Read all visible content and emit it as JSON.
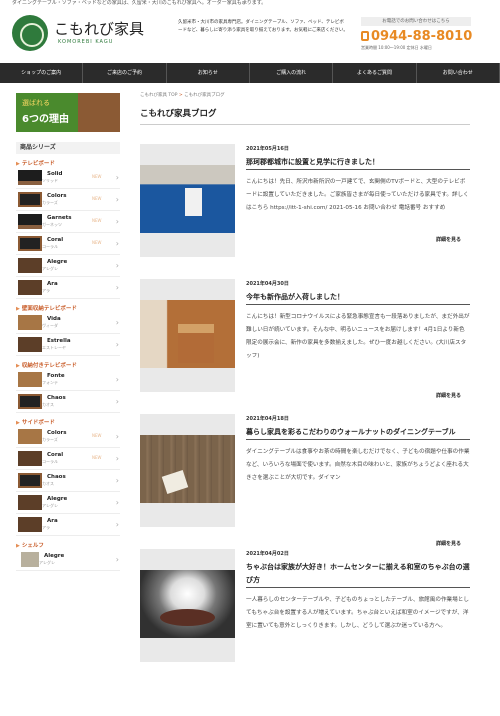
{
  "top_line": "ダイニングテーブル・ソファ・ベッドなどの家具は、久留米・大川のこもれび家具へ。オーダー家具も承ります。",
  "brand": {
    "name": "こもれび家具",
    "sub": "KOMOREBI KAGU"
  },
  "header_text": "久留米市・大川市の家具専門店。ダイニングテーブル、ソファ、ベッド、テレビボードなど、暮らしに寄り添う家具を取り揃えております。お気軽にご来店ください。",
  "contact": {
    "caption": "お電話でのお問い合わせはこちら",
    "phone": "0944-88-8010",
    "hours": "営業時間 10:00〜19:00  定休日 水曜日"
  },
  "nav": [
    "ショップのご案内",
    "ご来店のご予約",
    "お知らせ",
    "ご購入の流れ",
    "よくあるご質問",
    "お問い合わせ"
  ],
  "sidebar": {
    "banner": {
      "line1": "選ばれる",
      "line2": "6つの理由"
    },
    "series_title": "商品シリーズ",
    "categories": [
      {
        "name": "テレビボード",
        "items": [
          {
            "name": "Solid",
            "sub": "ソリッド"
          },
          {
            "name": "Colors",
            "sub": "カラーズ"
          },
          {
            "name": "Garnets",
            "sub": "ガーネッツ"
          },
          {
            "name": "Coral",
            "sub": "コーラル"
          },
          {
            "name": "Alegre",
            "sub": "アレグレ"
          },
          {
            "name": "Ara",
            "sub": "アラ"
          }
        ]
      },
      {
        "name": "壁面収納テレビボード",
        "items": [
          {
            "name": "Vida",
            "sub": "ヴィーダ"
          },
          {
            "name": "Estrella",
            "sub": "エストレーヤ"
          }
        ]
      },
      {
        "name": "収納付きテレビボード",
        "items": [
          {
            "name": "Fonte",
            "sub": "フォンテ"
          },
          {
            "name": "Chaos",
            "sub": "カオス"
          }
        ]
      },
      {
        "name": "サイドボード",
        "items": [
          {
            "name": "Colors",
            "sub": "カラーズ"
          },
          {
            "name": "Coral",
            "sub": "コーラル"
          },
          {
            "name": "Chaos",
            "sub": "カオス"
          },
          {
            "name": "Alegre",
            "sub": "アレグレ"
          },
          {
            "name": "Ara",
            "sub": "アラ"
          }
        ]
      },
      {
        "name": "シェルフ",
        "items": [
          {
            "name": "Alegre",
            "sub": "アレグレ"
          }
        ]
      }
    ],
    "new_label": "NEW"
  },
  "main": {
    "breadcrumb_home": "こもれび家具 TOP",
    "breadcrumb_current": "こもれび家具ブログ",
    "page_title": "こもれび家具ブログ",
    "more_label": "詳細を見る",
    "posts": [
      {
        "date": "2021年05月16日",
        "title": "那珂郡都城市に設置と見学に行きました！",
        "excerpt": "こんにちは！先日、所沢市新所沢の一戸建てで、玄関側のTVボードと、大型のテレビボードに設置していただきました。ご家族皆さまが毎日使っていただける家具です。詳しくはこちら https://itt-1-shi.com/ 2021-05-16 お問い合わせ 電話番号 おすすめ"
      },
      {
        "date": "2021年04月30日",
        "title": "今年も新作品が入荷しました！",
        "excerpt": "こんにちは！新型コロナウイルスによる緊急事態宣言も一段落ありましたが、まだ外出が難しい日が続いています。そんな中、明るいニュースをお届けします！4月1日より新色限定の展示会に、新作の家具を多数揃えました。ぜひ一度お越しください。(大川店スタッフ)"
      },
      {
        "date": "2021年04月18日",
        "title": "暮らし家具を彩るこだわりのウォールナットのダイニングテーブル",
        "excerpt": "ダイニングテーブルは食事やお茶の時間を楽しむだけでなく、子どもの宿題や仕事の作業など、いろいろな場面で使います。自然な木目の味わいと、家族がちょうどよく座れる大きさを選ぶことが大切です。ダイマン"
      },
      {
        "date": "2021年04月02日",
        "title": "ちゃぶ台は家族が大好き！ホームセンターに揃える和室のちゃぶ台の選び方",
        "excerpt": "一人暮らしのセンターテーブルや、子どものちょっとしたテーブル、旅館風の作業場としてもちゃぶ台を設置する人が増えています。ちゃぶ台といえば和室のイメージですが、洋室に置いても意外としっくりきます。しかし、どうして選ぶか迷っている方へ。"
      }
    ]
  }
}
